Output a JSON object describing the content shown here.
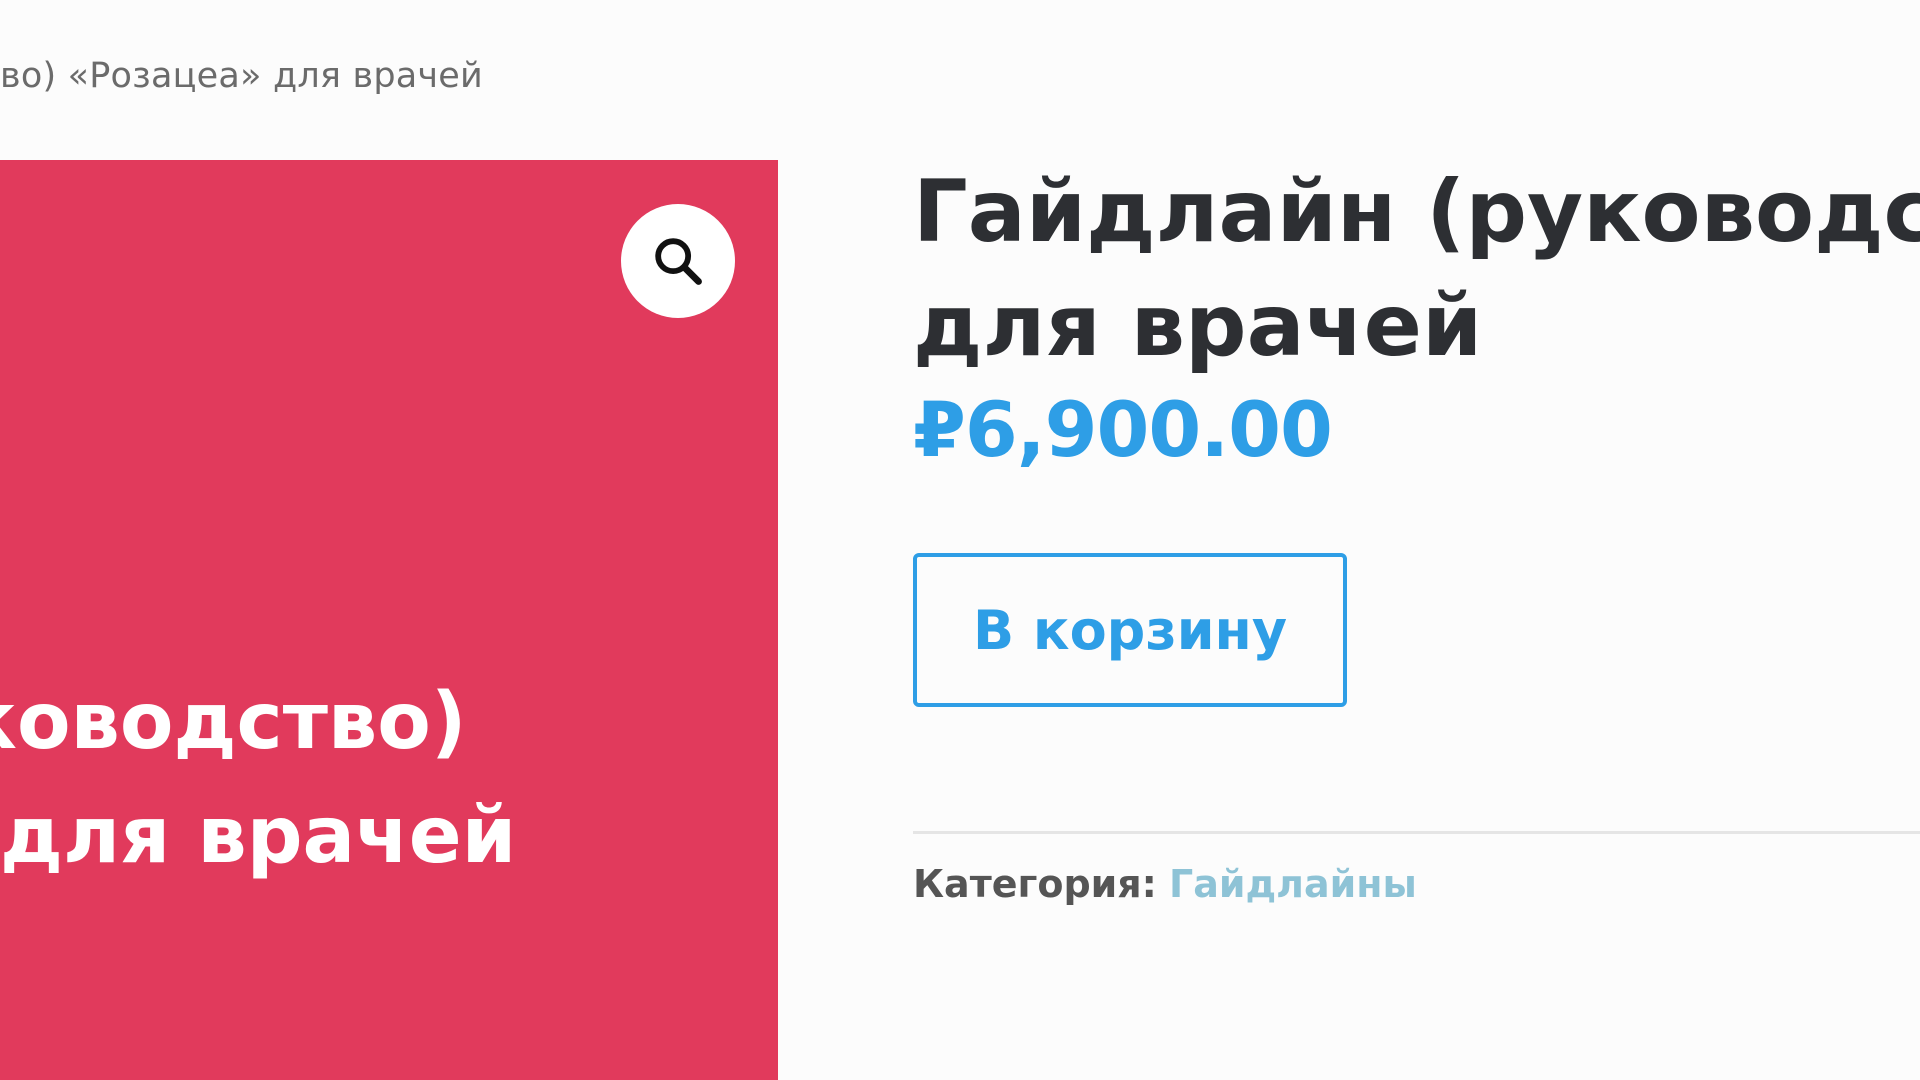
{
  "breadcrumb": {
    "current": "во) «Розацеа» для врачей"
  },
  "product_image": {
    "background_color": "#e13a5c",
    "line1": "ководство)",
    "line2": "для врачей",
    "zoom_icon": "search-icon"
  },
  "product": {
    "title_line1": "Гайдлайн (руководство",
    "title_line2": "для врачей",
    "price": "₽6,900.00",
    "add_to_cart_label": "В корзину",
    "category_label": "Категория:",
    "category_value": "Гайдлайны"
  },
  "colors": {
    "accent": "#2e9ee6",
    "title": "#2d2f33",
    "category_link": "#8ec3d6"
  }
}
